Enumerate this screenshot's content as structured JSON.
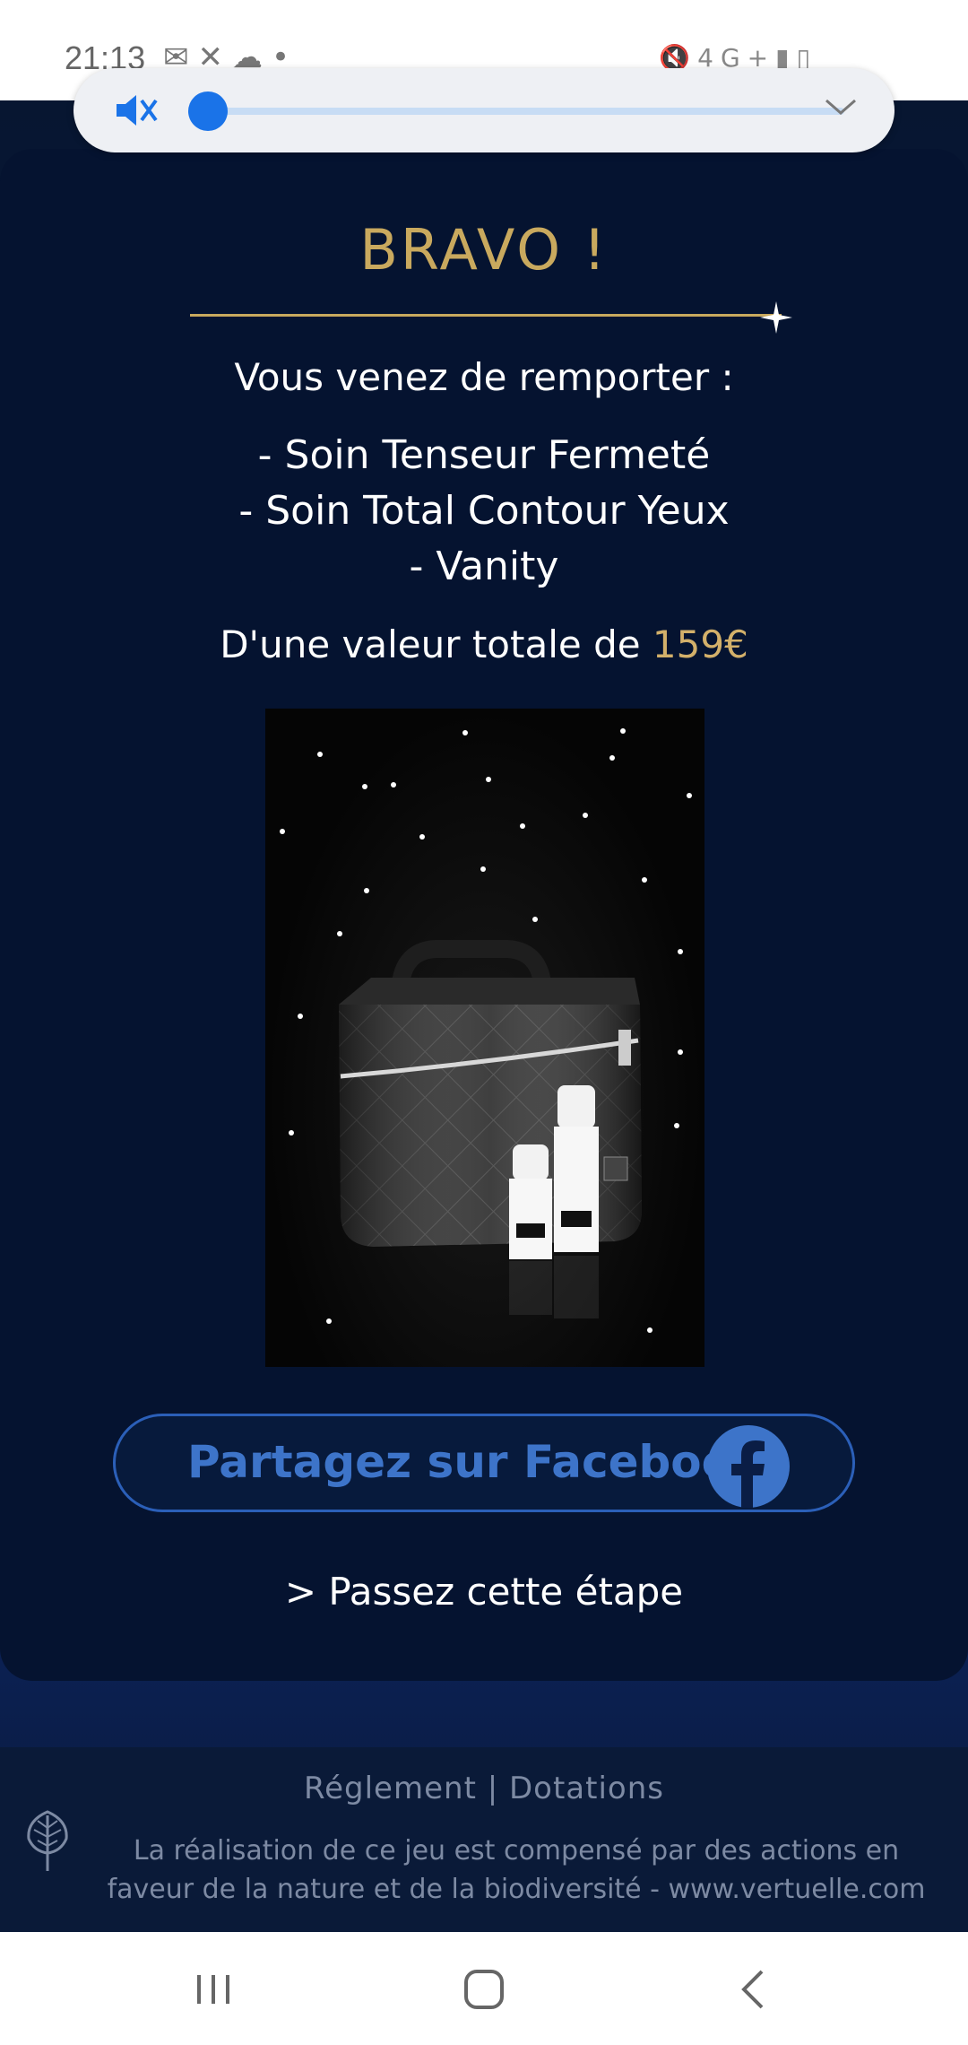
{
  "status_bar": {
    "time": "21:13",
    "left_icons": [
      "gmail-icon",
      "missed-call-icon",
      "cloud-icon",
      "dot-icon"
    ],
    "right_icons": [
      "mute-icon",
      "4g-plus-icon",
      "signal-icon",
      "battery-icon"
    ],
    "network_label": "4G+"
  },
  "volume": {
    "icon": "volume-muted-icon",
    "accent_color": "#1a73e8",
    "level_fraction": 0.0
  },
  "card": {
    "title": "BRAVO !",
    "subtitle": "Vous venez de remporter :",
    "items": [
      "- Soin Tenseur Fermeté",
      "- Soin Total Contour Yeux",
      "- Vanity"
    ],
    "value_prefix": "D'une valeur totale de ",
    "value_amount": "159€",
    "gold_color": "#c9a95e",
    "product_image_alt": "vanity-with-cream-bottles-image",
    "share_button_label": "Partagez sur Facebook",
    "share_icon": "facebook-icon",
    "skip_label": "> Passez cette étape"
  },
  "footer": {
    "links": "Réglement | Dotations",
    "text": "La réalisation de ce jeu est compensé par des actions en faveur de la nature et de la biodiversité - www.vertuelle.com",
    "icon": "tree-icon"
  },
  "nav_bar": {
    "recent_icon": "recent-apps-icon",
    "home_icon": "home-icon",
    "back_icon": "back-icon"
  }
}
